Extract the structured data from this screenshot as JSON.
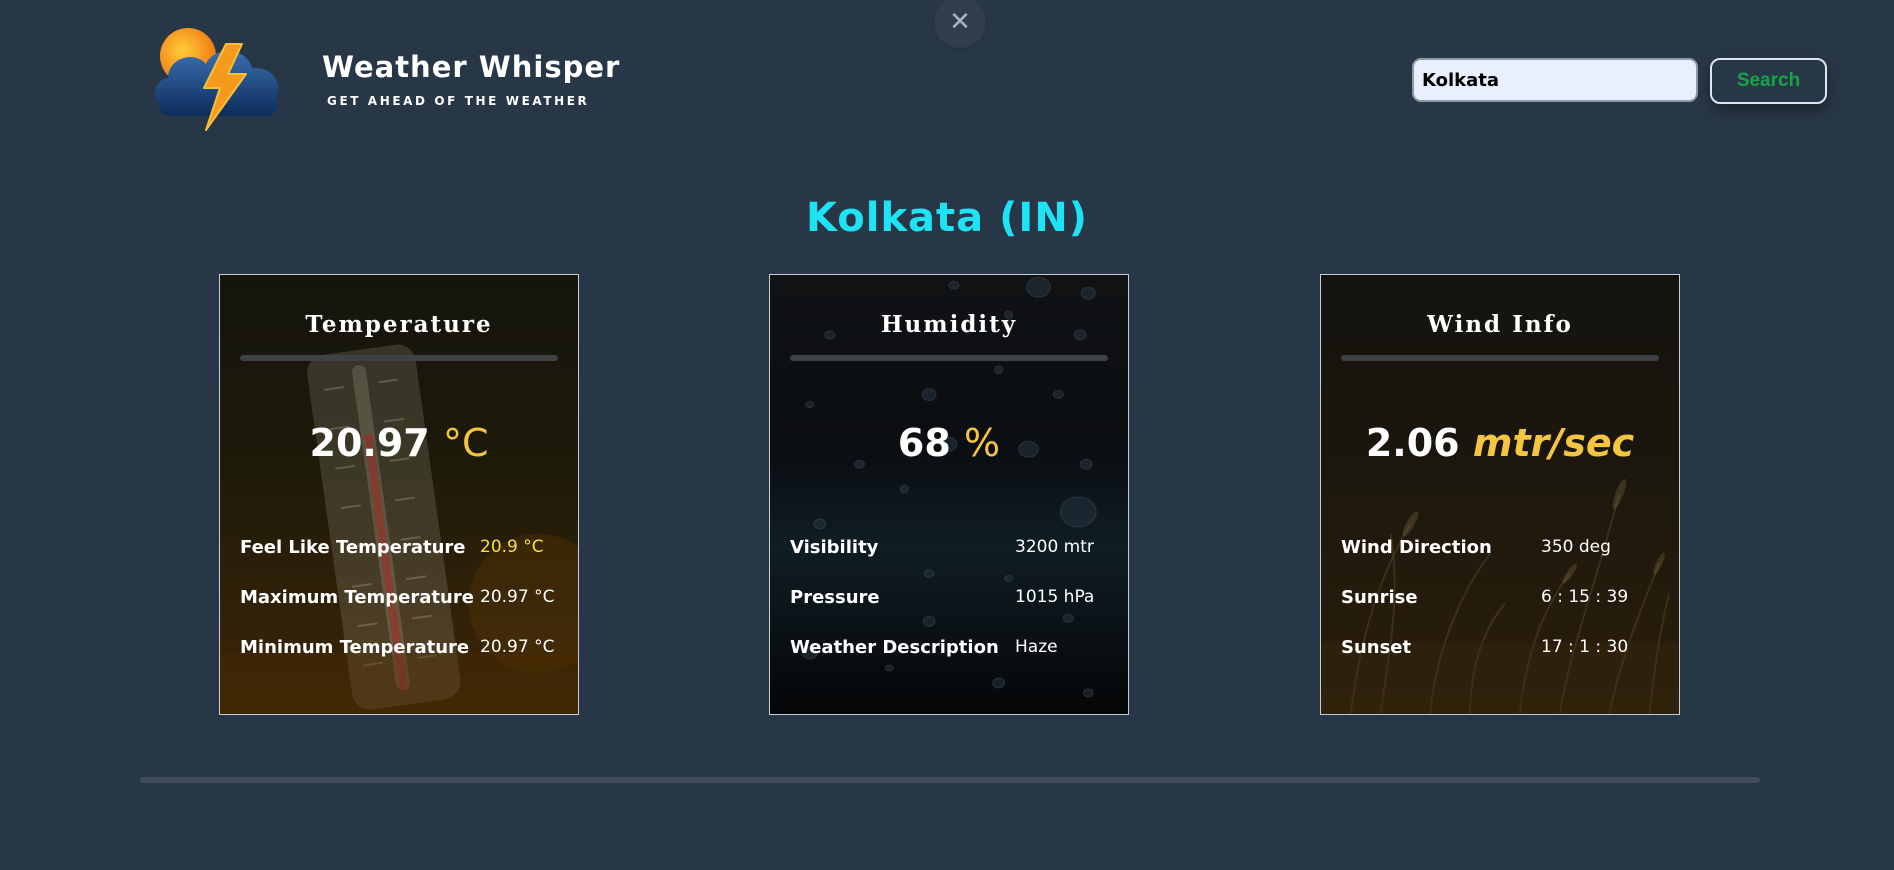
{
  "header": {
    "close_icon_glyph": "✕",
    "brand_title": "Weather Whisper",
    "brand_tagline": "GET AHEAD OF THE WEATHER",
    "logo_icon": "cloud-lightning-sun-icon"
  },
  "search": {
    "value": "Kolkata",
    "button_label": "Search"
  },
  "city_heading": "Kolkata (IN)",
  "cards": {
    "temperature": {
      "title": "Temperature",
      "value": "20.97",
      "unit": "°C",
      "rows": [
        {
          "label": "Feel Like Temperature",
          "value": "20.9 °C"
        },
        {
          "label": "Maximum Temperature",
          "value": "20.97 °C"
        },
        {
          "label": "Minimum Temperature",
          "value": "20.97 °C"
        }
      ]
    },
    "humidity": {
      "title": "Humidity",
      "value": "68",
      "unit": "%",
      "rows": [
        {
          "label": "Visibility",
          "value": "3200 mtr"
        },
        {
          "label": "Pressure",
          "value": "1015 hPa"
        },
        {
          "label": "Weather Description",
          "value": "Haze"
        }
      ]
    },
    "wind": {
      "title": "Wind Info",
      "value": "2.06",
      "unit": "mtr/sec",
      "rows": [
        {
          "label": "Wind Direction",
          "value": "350 deg"
        },
        {
          "label": "Sunrise",
          "value": "6 : 15 : 39"
        },
        {
          "label": "Sunset",
          "value": "17 : 1 : 30"
        }
      ]
    }
  },
  "colors": {
    "background": "#283747",
    "heading": "#1ee3f5",
    "unit_accent": "#f5c542",
    "feel_like_accent": "#f5e23a",
    "search_button_text": "#17a34a"
  }
}
